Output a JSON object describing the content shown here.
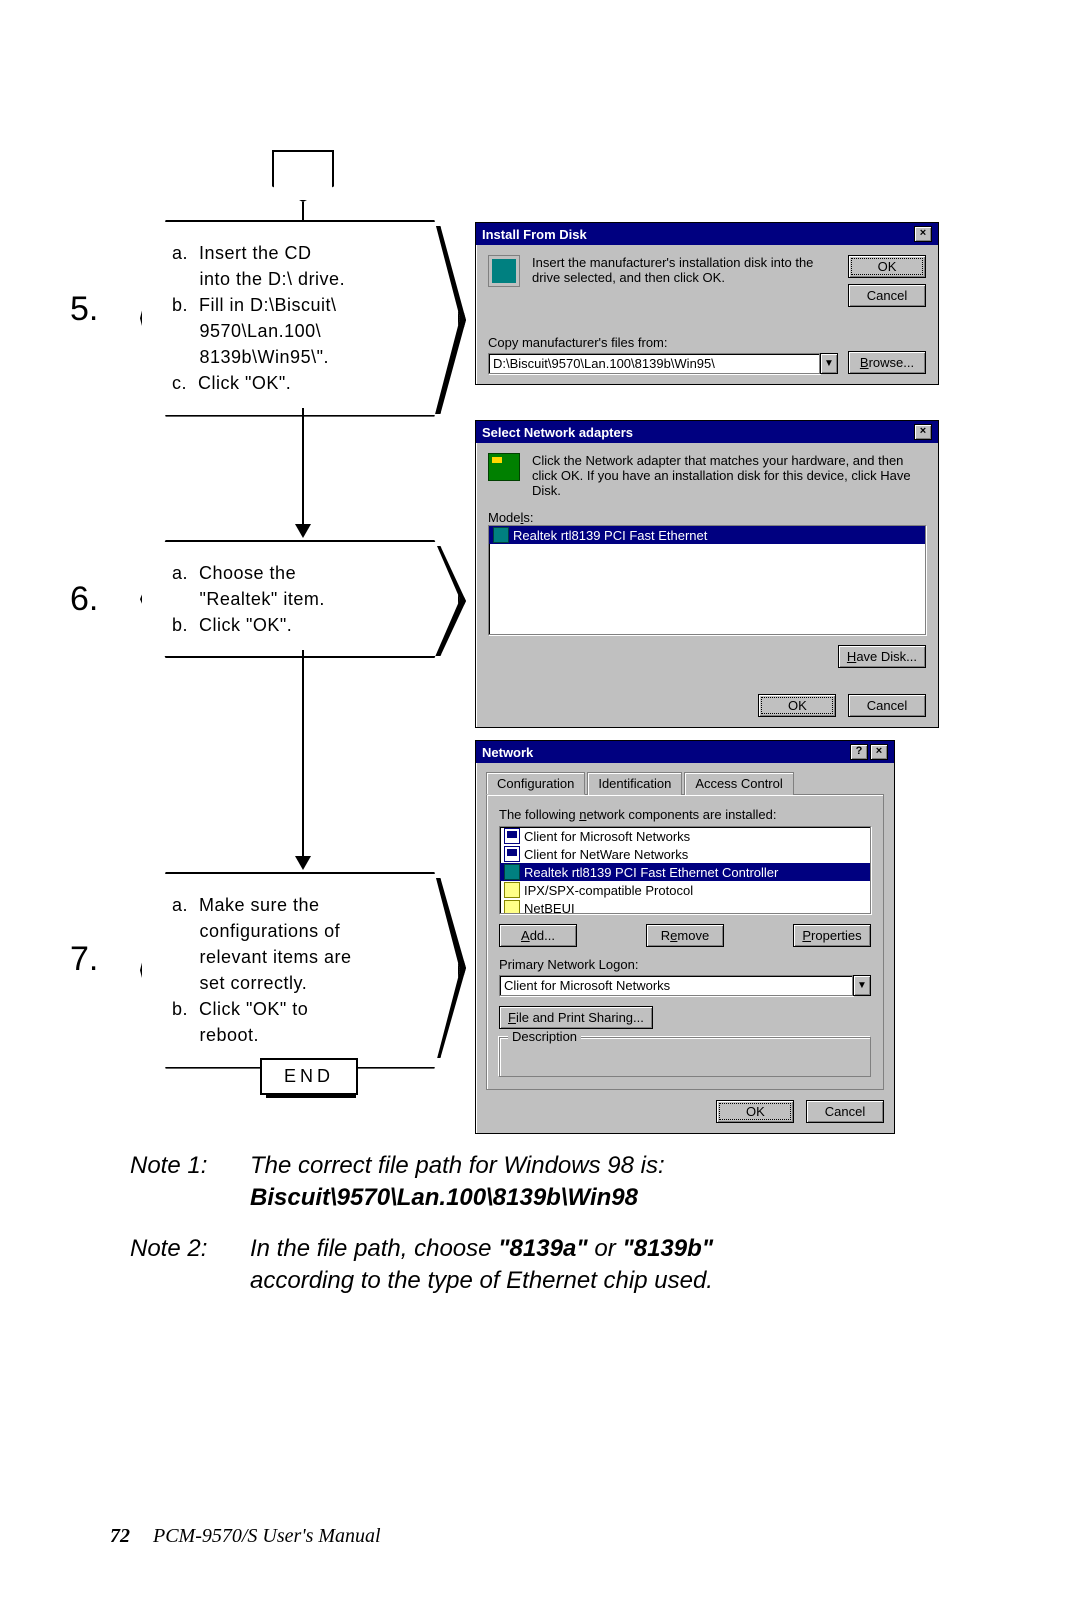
{
  "steps": {
    "s5": {
      "num": "5.",
      "lines": [
        "a.  Insert the CD",
        "     into the D:\\ drive.",
        "b.  Fill in D:\\Biscuit\\",
        "     9570\\Lan.100\\",
        "     8139b\\Win95\\\".",
        "c.  Click \"OK\"."
      ]
    },
    "s6": {
      "num": "6.",
      "lines": [
        "a.  Choose the",
        "     \"Realtek\" item.",
        "b.  Click \"OK\"."
      ]
    },
    "s7": {
      "num": "7.",
      "lines": [
        "a.  Make sure the",
        "     configurations of",
        "     relevant items are",
        "     set correctly.",
        "b.  Click \"OK\" to",
        "     reboot."
      ]
    },
    "end": "END"
  },
  "dlg1": {
    "title": "Install From Disk",
    "msg": "Insert the manufacturer's installation disk into the drive selected, and then click OK.",
    "copy_label": "Copy manufacturer's files from:",
    "path": "D:\\Biscuit\\9570\\Lan.100\\8139b\\Win95\\",
    "ok": "OK",
    "cancel": "Cancel",
    "browse": "Browse..."
  },
  "dlg2": {
    "title": "Select Network adapters",
    "msg": "Click the Network adapter that matches your hardware, and then click OK. If you have an installation disk for this device, click Have Disk.",
    "models_label": "Models:",
    "model_item": "Realtek rtl8139 PCI Fast Ethernet",
    "havedisk": "Have Disk...",
    "ok": "OK",
    "cancel": "Cancel"
  },
  "dlg3": {
    "title": "Network",
    "tabs": [
      "Configuration",
      "Identification",
      "Access Control"
    ],
    "comp_label": "The following network components are installed:",
    "components": [
      {
        "icon": "comp",
        "label": "Client for Microsoft Networks",
        "sel": false
      },
      {
        "icon": "comp",
        "label": "Client for NetWare Networks",
        "sel": false
      },
      {
        "icon": "net",
        "label": "Realtek rtl8139 PCI Fast Ethernet Controller",
        "sel": true
      },
      {
        "icon": "proto",
        "label": "IPX/SPX-compatible Protocol",
        "sel": false
      },
      {
        "icon": "proto",
        "label": "NetBEUI",
        "sel": false
      }
    ],
    "add": "Add...",
    "remove": "Remove",
    "props": "Properties",
    "logon_label": "Primary Network Logon:",
    "logon_value": "Client for Microsoft Networks",
    "fps": "File and Print Sharing...",
    "desc": "Description",
    "ok": "OK",
    "cancel": "Cancel"
  },
  "notes": {
    "n1_label": "Note 1:",
    "n1_a": "The correct file path for Windows 98 is:",
    "n1_b": "Biscuit\\9570\\Lan.100\\8139b\\Win98",
    "n2_label": "Note 2:",
    "n2_a": "In the file path, choose ",
    "n2_b": "\"8139a\"",
    "n2_c": " or ",
    "n2_d": "\"8139b\"",
    "n2_e": " according to the type of Ethernet chip used."
  },
  "footer": {
    "page": "72",
    "title": "PCM-9570/S  User's Manual"
  }
}
